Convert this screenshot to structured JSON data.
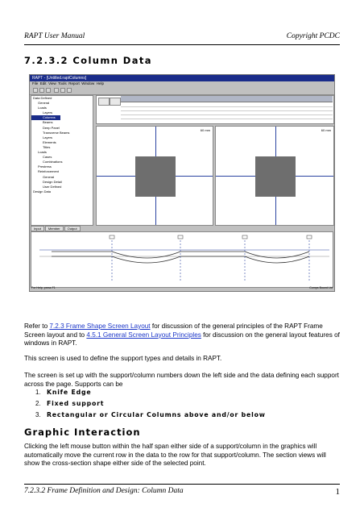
{
  "header": {
    "left": "RAPT User Manual",
    "right": "Copyright PCDC"
  },
  "section_title": "7.2.3.2 Column Data",
  "screenshot": {
    "title_bar": "RAPT - [Untitled.raptColumns]",
    "menus": [
      "File",
      "Edit",
      "View",
      "Tools",
      "Report",
      "Window",
      "Help"
    ],
    "tree": [
      "Data Defined",
      "General",
      "Loads",
      "Layers",
      "Columns",
      "Beams",
      "Deep Panel",
      "Transverse Beams",
      "Layers",
      "Elements",
      "Titles",
      "Loads",
      "Cases",
      "Combinations",
      "Prestress",
      "Reinforcement",
      "General",
      "Design Detail",
      "User Defined",
      "Design Data"
    ],
    "tabs": [
      "Input",
      "Member",
      "Output"
    ],
    "section_labels": [
      "60 mm",
      "60 mm"
    ],
    "status_left": "For Help, press F1",
    "status_right": "Comps  Bound Ltd"
  },
  "paragraphs": {
    "p1_pre": "Refer to ",
    "p1_link1": "7.2.3 Frame Shape Screen Layout",
    "p1_mid": " for discussion of the general principles of the RAPT Frame Screen layout and to ",
    "p1_link2": "4.5.1 General Screen Layout Principles",
    "p1_post": " for discussion on the general layout features of windows in RAPT.",
    "p2": "This screen is used to define the support types and details in RAPT.",
    "p3": "The screen is set up with the support/column numbers down the left side and the data defining each support across the page. Supports can be"
  },
  "list": [
    {
      "num": "1.",
      "text": "Knife Edge"
    },
    {
      "num": "2.",
      "text": "Fixed support"
    },
    {
      "num": "3.",
      "text": "Rectangular or Circular Columns above and/or below"
    }
  ],
  "heading2": "Graphic Interaction",
  "p4": "Clicking the left mouse button within the half span either side of a support/column in the graphics will automatically move the current row in the data to the row for that support/column. The section views will show the cross-section shape either side of the selected point.",
  "footer": {
    "left": "7.2.3.2 Frame Definition and Design: Column Data",
    "page": "1"
  }
}
